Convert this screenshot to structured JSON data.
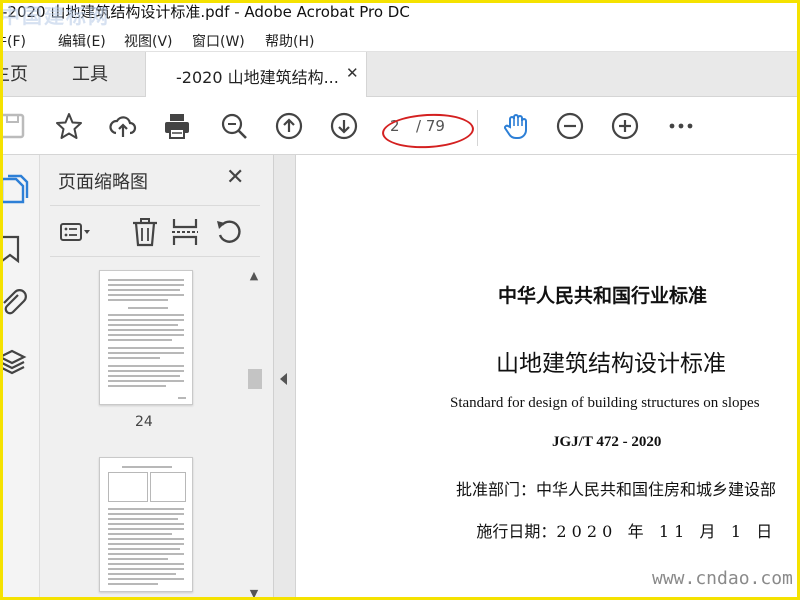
{
  "window": {
    "title": "-2020 山地建筑结构设计标准.pdf - Adobe Acrobat Pro DC",
    "logo_watermark": "中国建标网"
  },
  "menu": {
    "items": [
      "文件(F)",
      "编辑(E)",
      "视图(V)",
      "窗口(W)",
      "帮助(H)"
    ],
    "first_visible": "件(F)"
  },
  "tabs": {
    "home": "主页",
    "tools": "工具",
    "document": "-2020 山地建筑结构...",
    "close_symbol": "✕"
  },
  "toolbar": {
    "current_page": "2",
    "page_total": "/ 79"
  },
  "thumbnails_panel": {
    "title": "页面缩略图",
    "close_symbol": "✕",
    "pages": [
      {
        "number": "24"
      }
    ]
  },
  "document": {
    "line1": "中华人民共和国行业标准",
    "line2": "山地建筑结构设计标准",
    "line3": "Standard for design of building structures on slopes",
    "line4": "JGJ/T 472 - 2020",
    "line5_label": "批准部门：",
    "line5_value": "中华人民共和国住房和城乡建设部",
    "line6_label": "施行日期：",
    "line6_value": "2 0 2 0   年   1 1   月   1   日"
  },
  "watermark": "www.cndao.com",
  "colors": {
    "frame": "#f5e200",
    "hand_tool_active": "#2d7fd6",
    "annotation_oval": "#d42020"
  },
  "icons": {
    "toolbar": [
      "save-icon",
      "star-icon",
      "cloud-upload-icon",
      "print-icon",
      "zoom-out-search-icon",
      "page-up-icon",
      "page-down-icon",
      "hand-icon",
      "zoom-out-icon",
      "zoom-in-icon",
      "more-icon"
    ],
    "left_nav": [
      "page-thumbnails-icon",
      "bookmark-icon",
      "attachment-icon",
      "layers-icon"
    ]
  }
}
